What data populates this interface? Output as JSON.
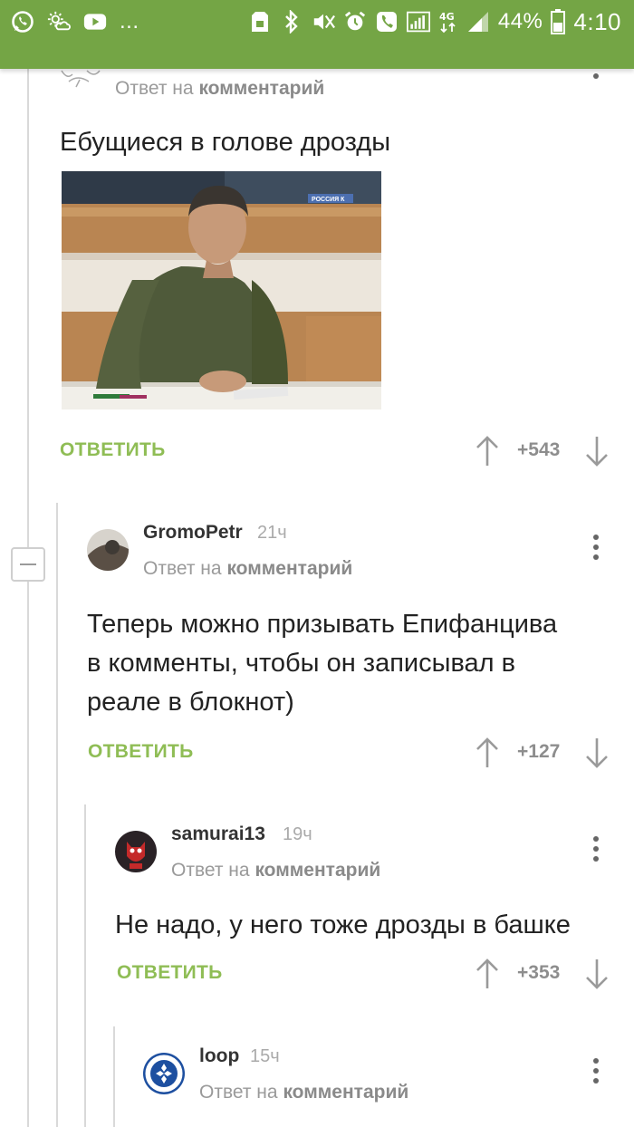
{
  "status_bar": {
    "left_more": "...",
    "battery": "44%",
    "time": "4:10",
    "net": "4G"
  },
  "comments": [
    {
      "reply_to_label": "Ответ на",
      "reply_to_target": "комментарий",
      "text": "Ебущиеся в голове дрозды",
      "image_logo": "РОССИЯ К",
      "reply_label": "ОТВЕТИТЬ",
      "score": "+543"
    },
    {
      "username": "GromoPetr",
      "time": "21ч",
      "reply_to_label": "Ответ на",
      "reply_to_target": "комментарий",
      "text_lines": [
        "Теперь можно призывать Епифанцива",
        "в комменты, чтобы он записывал в",
        "реале в блокнот)"
      ],
      "reply_label": "ОТВЕТИТЬ",
      "score": "+127"
    },
    {
      "username": "samurai13",
      "time": "19ч",
      "reply_to_label": "Ответ на",
      "reply_to_target": "комментарий",
      "text": "Не надо, у него тоже дрозды в башке",
      "reply_label": "ОТВЕТИТЬ",
      "score": "+353"
    },
    {
      "username": "loop",
      "time": "15ч",
      "reply_to_label": "Ответ на",
      "reply_to_target": "комментарий"
    }
  ]
}
